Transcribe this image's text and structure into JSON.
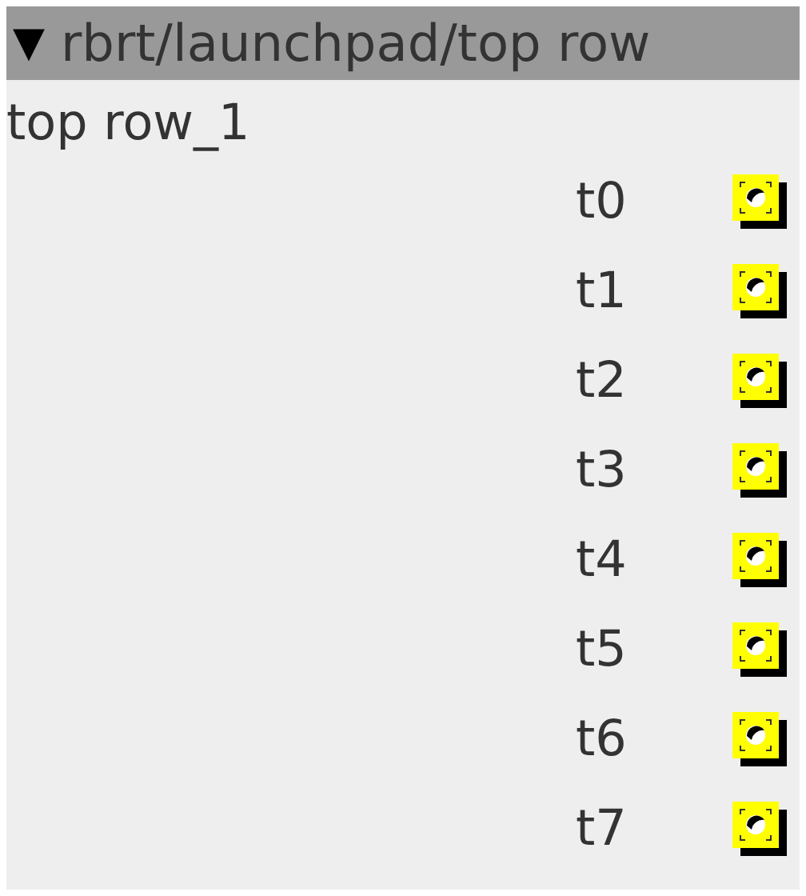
{
  "header": {
    "arrow": "▼",
    "title": "rbrt/launchpad/top row"
  },
  "group": {
    "title": "top row_1"
  },
  "buttons": [
    {
      "label": "t0"
    },
    {
      "label": "t1"
    },
    {
      "label": "t2"
    },
    {
      "label": "t3"
    },
    {
      "label": "t4"
    },
    {
      "label": "t5"
    },
    {
      "label": "t6"
    },
    {
      "label": "t7"
    }
  ]
}
